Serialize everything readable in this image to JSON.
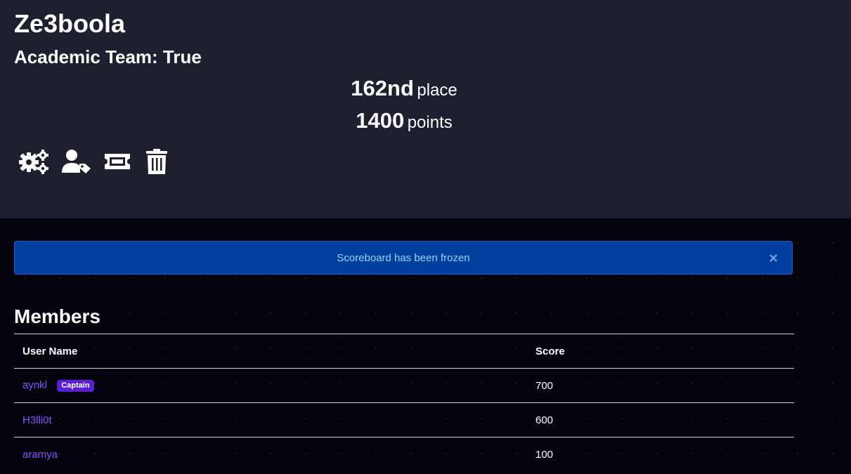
{
  "team": {
    "name": "Ze3boola",
    "affiliation": "Academic Team: True"
  },
  "stats": {
    "place_value": "162nd",
    "place_unit": "place",
    "points_value": "1400",
    "points_unit": "points"
  },
  "actions": [
    {
      "icon": "settings-gears-icon"
    },
    {
      "icon": "user-tag-icon"
    },
    {
      "icon": "ticket-icon"
    },
    {
      "icon": "trash-icon"
    }
  ],
  "alert": {
    "message": "Scoreboard has been frozen",
    "close_label": "×"
  },
  "members": {
    "title": "Members",
    "columns": [
      "User Name",
      "Score"
    ],
    "rows": [
      {
        "name": "aynkl",
        "badge": "Captain",
        "score": "700"
      },
      {
        "name": "H3lli0t",
        "score": "600"
      },
      {
        "name": "aramya",
        "score": "100"
      }
    ]
  },
  "colors": {
    "hero_bg": "#1e2030",
    "page_bg": "#03030d",
    "alert_bg": "#003e9e",
    "alert_text": "#8fd7ff",
    "link": "#8a4dff",
    "badge_bg": "#5b1ed6"
  }
}
